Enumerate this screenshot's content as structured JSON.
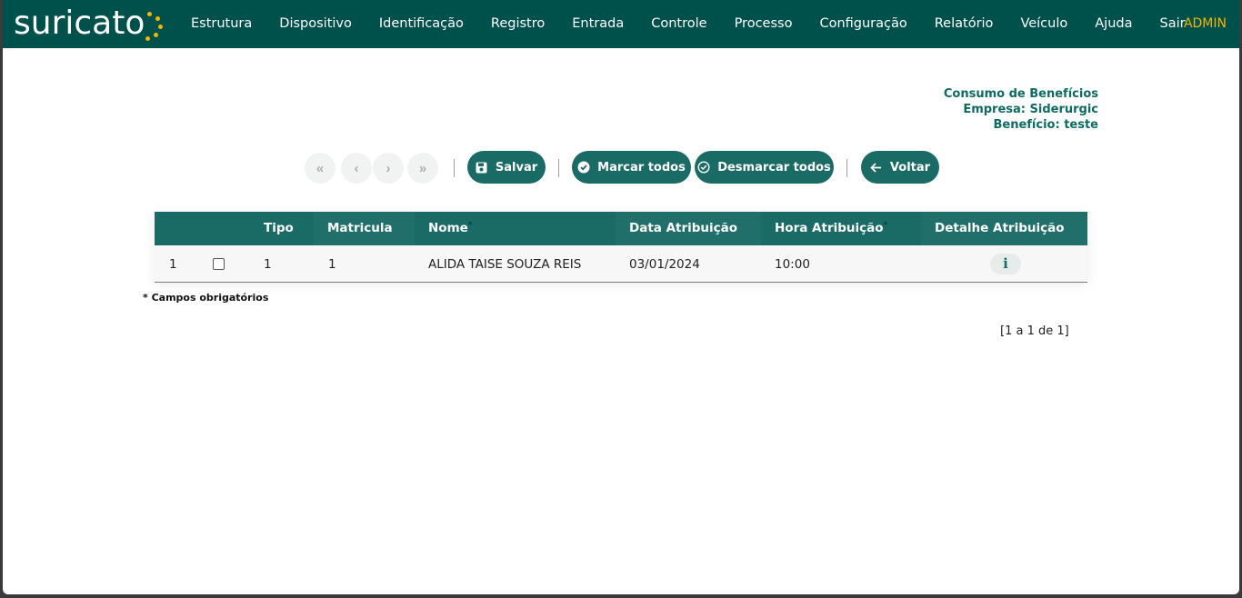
{
  "app": {
    "logo_text": "suricato",
    "user": "ADMIN"
  },
  "nav": {
    "items": [
      "Estrutura",
      "Dispositivo",
      "Identificação",
      "Registro",
      "Entrada",
      "Controle",
      "Processo",
      "Configuração",
      "Relatório",
      "Veículo",
      "Ajuda",
      "Sair"
    ]
  },
  "info": {
    "title": "Consumo de Benefícios",
    "empresa": "Empresa: Siderurgic",
    "beneficio": "Benefício: teste"
  },
  "toolbar": {
    "first_icon": "«",
    "prev_icon": "‹",
    "next_icon": "›",
    "last_icon": "»",
    "save_label": "Salvar",
    "mark_all_label": "Marcar todos",
    "unmark_all_label": "Desmarcar todos",
    "back_label": "Voltar"
  },
  "table": {
    "columns": [
      "Tipo",
      "Matricula",
      "Nome",
      "Data Atribuição",
      "Hora Atribuição",
      "Detalhe Atribuição"
    ],
    "required_mark": "*",
    "rows": [
      {
        "index": "1",
        "tipo": "1",
        "matricula": "1",
        "nome": "ALIDA TAISE SOUZA REIS",
        "data": "03/01/2024",
        "hora": "10:00",
        "detail_icon": "i",
        "checked": false
      }
    ]
  },
  "note": "* Campos obrigatórios",
  "pagination": "[1 a 1 de 1]",
  "colors": {
    "brand": "#00504b",
    "accent": "#1a6b66",
    "admin": "#f2b705"
  }
}
